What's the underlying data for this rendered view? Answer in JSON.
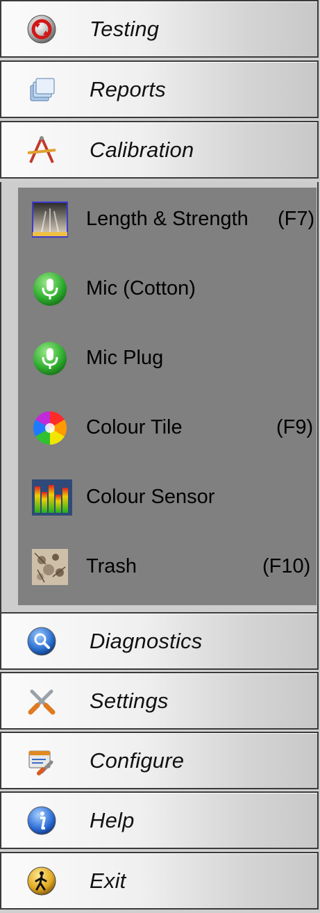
{
  "sections_top": [
    {
      "label": "Testing",
      "icon": "testing-icon"
    },
    {
      "label": "Reports",
      "icon": "reports-icon"
    },
    {
      "label": "Calibration",
      "icon": "calibration-icon"
    }
  ],
  "calibration_items": [
    {
      "label": "Length & Strength",
      "key": "(F7)",
      "icon": "length-strength-icon"
    },
    {
      "label": "Mic (Cotton)",
      "key": "",
      "icon": "microphone-icon"
    },
    {
      "label": "Mic Plug",
      "key": "",
      "icon": "microphone-icon"
    },
    {
      "label": "Colour Tile",
      "key": "(F9)",
      "icon": "colour-wheel-icon"
    },
    {
      "label": "Colour Sensor",
      "key": "",
      "icon": "colour-sensor-icon"
    },
    {
      "label": "Trash",
      "key": "(F10)",
      "icon": "trash-sample-icon"
    }
  ],
  "sections_bottom": [
    {
      "label": "Diagnostics",
      "icon": "magnifier-icon"
    },
    {
      "label": "Settings",
      "icon": "tools-icon"
    },
    {
      "label": "Configure",
      "icon": "configure-icon"
    },
    {
      "label": "Help",
      "icon": "info-icon"
    },
    {
      "label": "Exit",
      "icon": "exit-icon"
    }
  ],
  "colors": {
    "panel_bg": "#808080",
    "header_gradient_start": "#fbfbfb",
    "header_gradient_end": "#c8c8c8",
    "border": "#3a3a3a"
  }
}
